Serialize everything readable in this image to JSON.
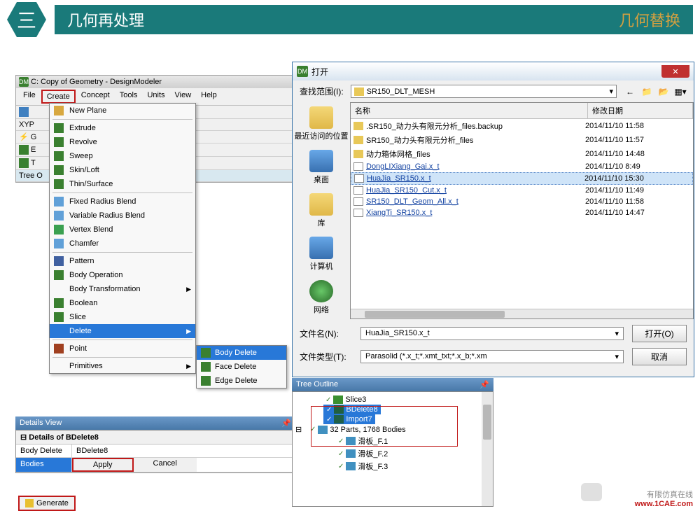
{
  "banner": {
    "hex": "三",
    "title": "几何再处理",
    "right": "几何替换"
  },
  "dm": {
    "title": "C: Copy of Geometry - DesignModeler",
    "menu": {
      "file": "File",
      "create": "Create",
      "concept": "Concept",
      "tools": "Tools",
      "units": "Units",
      "view": "View",
      "help": "Help"
    },
    "toolbar": {
      "xyp": "XYP",
      "g": "G",
      "e": "E",
      "t": "T",
      "tree": "Tree O"
    }
  },
  "createMenu": {
    "newPlane": "New Plane",
    "extrude": "Extrude",
    "revolve": "Revolve",
    "sweep": "Sweep",
    "skinloft": "Skin/Loft",
    "thinSurface": "Thin/Surface",
    "fixedRadBlend": "Fixed Radius Blend",
    "varRadBlend": "Variable Radius Blend",
    "vertexBlend": "Vertex Blend",
    "chamfer": "Chamfer",
    "pattern": "Pattern",
    "bodyOp": "Body Operation",
    "bodyTrans": "Body Transformation",
    "boolean": "Boolean",
    "slice": "Slice",
    "delete": "Delete",
    "point": "Point",
    "primitives": "Primitives"
  },
  "deleteSub": {
    "bodyDelete": "Body Delete",
    "faceDelete": "Face Delete",
    "edgeDelete": "Edge Delete"
  },
  "details": {
    "title": "Details View",
    "hdr": "Details of BDelete8",
    "row1_label": "Body Delete",
    "row1_val": "BDelete8",
    "row2_label": "Bodies",
    "apply": "Apply",
    "cancel": "Cancel"
  },
  "generate": "Generate",
  "fileDialog": {
    "title": "打开",
    "lookInLabel": "查找范围(I):",
    "lookInValue": "SR150_DLT_MESH",
    "places": {
      "recent": "最近访问的位置",
      "desktop": "桌面",
      "library": "库",
      "computer": "计算机",
      "network": "网络"
    },
    "cols": {
      "name": "名称",
      "date": "修改日期"
    },
    "rows": [
      {
        "name": ".SR150_动力头有限元分析_files.backup",
        "date": "2014/11/10 11:58",
        "type": "folder"
      },
      {
        "name": "SR150_动力头有限元分析_files",
        "date": "2014/11/10 11:57",
        "type": "folder"
      },
      {
        "name": "动力箱体网格_files",
        "date": "2014/11/10 14:48",
        "type": "folder"
      },
      {
        "name": "DongLIXiang_Gai.x_t",
        "date": "2014/11/10 8:49",
        "type": "file"
      },
      {
        "name": "HuaJia_SR150.x_t",
        "date": "2014/11/10 15:30",
        "type": "file",
        "selected": true
      },
      {
        "name": "HuaJia_SR150_Cut.x_t",
        "date": "2014/11/10 11:49",
        "type": "file"
      },
      {
        "name": "SR150_DLT_Geom_All.x_t",
        "date": "2014/11/10 11:58",
        "type": "file"
      },
      {
        "name": "XiangTi_SR150.x_t",
        "date": "2014/11/10 14:47",
        "type": "file"
      }
    ],
    "fileNameLabel": "文件名(N):",
    "fileNameValue": "HuaJia_SR150.x_t",
    "fileTypeLabel": "文件类型(T):",
    "fileTypeValue": "Parasolid (*.x_t;*.xmt_txt;*.x_b;*.xm",
    "openBtn": "打开(O)",
    "cancelBtn": "取消"
  },
  "tree": {
    "title": "Tree Outline",
    "nodes": {
      "slice3": "Slice3",
      "bdelete8": "BDelete8",
      "import7": "Import7",
      "parts": "32 Parts, 1768 Bodies",
      "hb1": "滑板_F.1",
      "hb2": "滑板_F.2",
      "hb3": "滑板_F.3"
    }
  },
  "watermark": {
    "line1": "有限仿真在线",
    "line2": "www.1CAE.com"
  }
}
